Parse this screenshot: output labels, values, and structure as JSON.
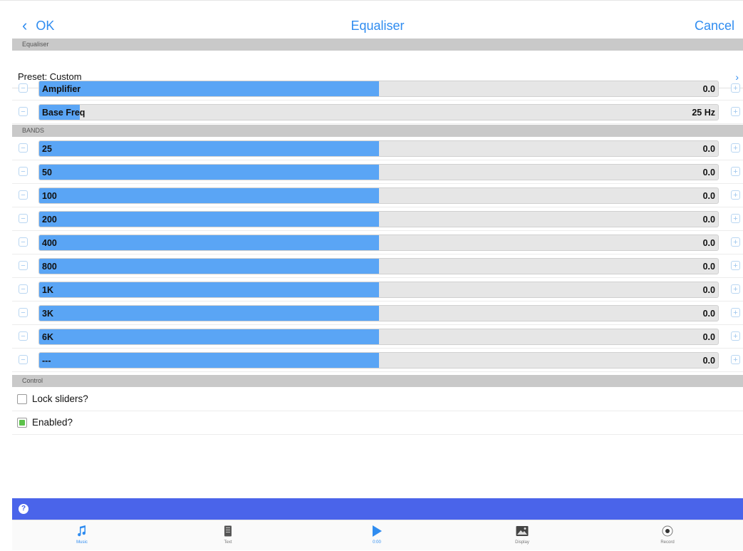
{
  "nav": {
    "ok_label": "OK",
    "title": "Equaliser",
    "cancel_label": "Cancel"
  },
  "sections": {
    "equaliser": "Equaliser",
    "bands": "BANDS",
    "control": "Control"
  },
  "preset": {
    "label": "Preset: Custom"
  },
  "settings": [
    {
      "label": "Amplifier",
      "value": "0.0",
      "level": 0.5
    },
    {
      "label": "Base Freq",
      "value": "25 Hz",
      "level": 0.06
    }
  ],
  "bands": [
    {
      "label": "25",
      "value": "0.0",
      "level": 0.5
    },
    {
      "label": "50",
      "value": "0.0",
      "level": 0.5
    },
    {
      "label": "100",
      "value": "0.0",
      "level": 0.5
    },
    {
      "label": "200",
      "value": "0.0",
      "level": 0.5
    },
    {
      "label": "400",
      "value": "0.0",
      "level": 0.5
    },
    {
      "label": "800",
      "value": "0.0",
      "level": 0.5
    },
    {
      "label": "1K",
      "value": "0.0",
      "level": 0.5
    },
    {
      "label": "3K",
      "value": "0.0",
      "level": 0.5
    },
    {
      "label": "6K",
      "value": "0.0",
      "level": 0.5
    },
    {
      "label": "---",
      "value": "0.0",
      "level": 0.5
    }
  ],
  "control": {
    "lock_label": "Lock sliders?",
    "lock_checked": false,
    "enabled_label": "Enabled?",
    "enabled_checked": true
  },
  "tabs": [
    {
      "label": "Music",
      "icon": "music-note-icon",
      "active": true
    },
    {
      "label": "Text",
      "icon": "document-icon",
      "active": false
    },
    {
      "label": "0:00",
      "icon": "play-icon",
      "active": true
    },
    {
      "label": "Display",
      "icon": "image-icon",
      "active": false
    },
    {
      "label": "Record",
      "icon": "record-icon",
      "active": false
    }
  ],
  "colors": {
    "accent": "#2f8cf0",
    "slider_fill": "#5aa5f5",
    "info_bar": "#4a64ea",
    "enabled_green": "#5cc24a"
  }
}
